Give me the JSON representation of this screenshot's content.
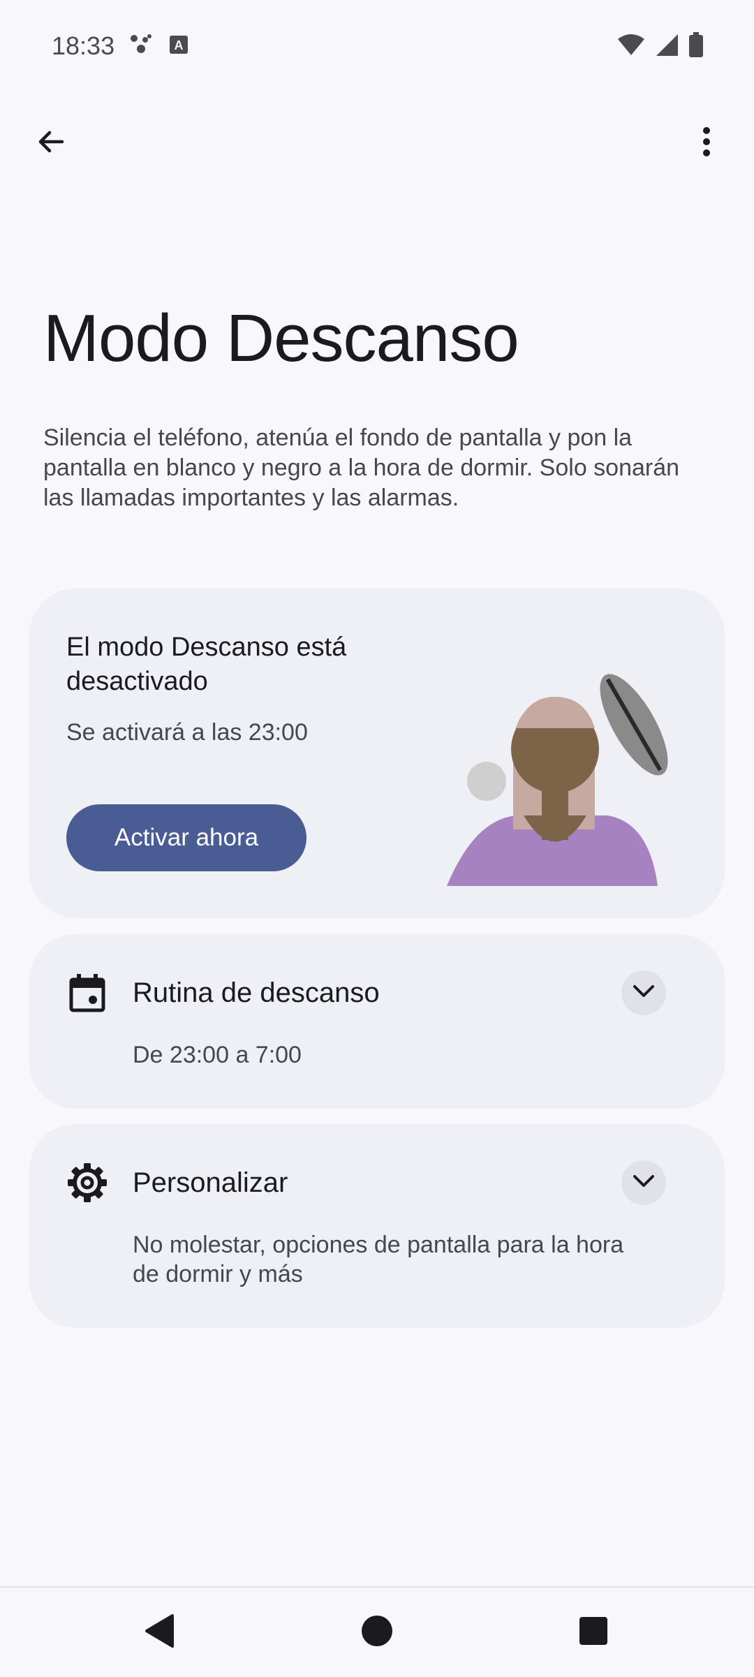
{
  "status_bar": {
    "time": "18:33",
    "icons": [
      "assistant-icon",
      "keyboard-a-icon",
      "wifi-icon",
      "signal-icon",
      "battery-icon"
    ]
  },
  "app_bar": {
    "back_icon": "arrow-back-icon",
    "menu_icon": "more-vert-icon"
  },
  "page": {
    "title": "Modo Descanso",
    "description": "Silencia el teléfono, atenúa el fondo de pantalla y pon la pantalla en blanco y negro a la hora de dormir. Solo sonarán las llamadas importantes y las alarmas."
  },
  "status_card": {
    "title": "El modo Descanso está desactivado",
    "subtitle": "Se activará a las 23:00",
    "button_label": "Activar ahora",
    "button_color": "#4a5c94"
  },
  "routine": {
    "icon": "calendar-icon",
    "title": "Rutina de descanso",
    "subtitle": "De 23:00 a 7:00"
  },
  "customize": {
    "icon": "gear-icon",
    "title": "Personalizar",
    "subtitle": "No molestar, opciones de pantalla para la hora de dormir y más"
  },
  "nav_bar": {
    "icons": [
      "nav-back-icon",
      "nav-home-icon",
      "nav-recents-icon"
    ]
  }
}
